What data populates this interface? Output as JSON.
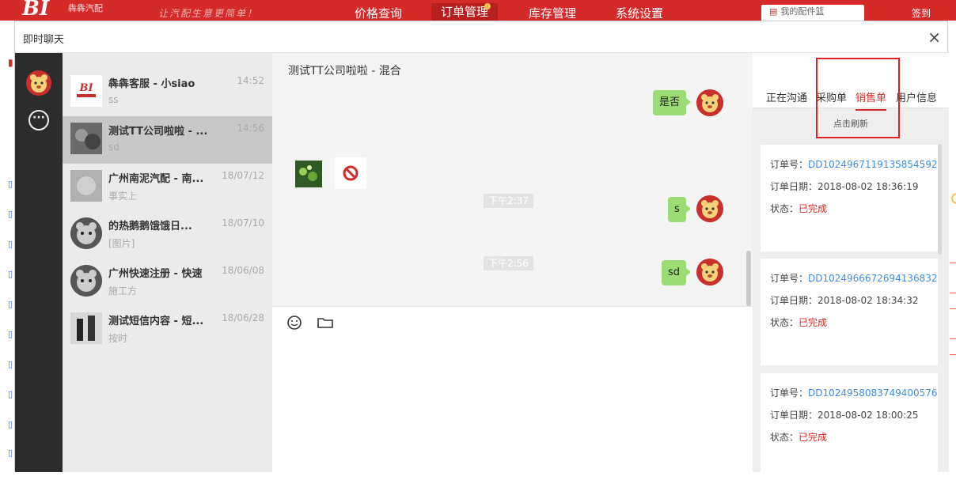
{
  "bg_app": {
    "logo": "BI",
    "brand": "犇犇汽配",
    "slogan": "让汽配生意更简单！",
    "nav": [
      "价格查询",
      "订单管理",
      "库存管理",
      "系统设置"
    ],
    "cart_label": "我的配件篮",
    "sign_label": "签到"
  },
  "window": {
    "title": "即时聊天",
    "close_glyph": "×"
  },
  "conversations": [
    {
      "name": "犇犇客服 - 小siao",
      "time": "14:52",
      "preview": "ss"
    },
    {
      "name": "测试TT公司啦啦 - ...",
      "time": "14:56",
      "preview": "sd"
    },
    {
      "name": "广州南泥汽配 - 南...",
      "time": "18/07/12",
      "preview": "事实上"
    },
    {
      "name": "的热鹅鹅饿饿日...",
      "time": "18/07/10",
      "preview": "[图片]"
    },
    {
      "name": "广州快速注册 - 快速",
      "time": "18/06/08",
      "preview": "施工方"
    },
    {
      "name": "测试短信内容 - 短...",
      "time": "18/06/28",
      "preview": "按时"
    }
  ],
  "chat": {
    "title": "测试TT公司啦啦 - 混合",
    "messages": {
      "m1": "是否",
      "ts1": "下午2:37",
      "m2": "s",
      "ts2": "下午2:56",
      "m3": "sd"
    }
  },
  "side": {
    "tabs": [
      "正在沟通",
      "采购单",
      "销售单",
      "用户信息"
    ],
    "active_tab": "销售单",
    "refresh_label": "点击刷新",
    "labels": {
      "order_no": "订单号：",
      "order_date": "订单日期：",
      "status": "状态："
    },
    "orders": [
      {
        "no": "DD1024967119135854592",
        "date": "2018-08-02 18:36:19",
        "status": "已完成"
      },
      {
        "no": "DD1024966672694136832",
        "date": "2018-08-02 18:34:32",
        "status": "已完成"
      },
      {
        "no": "DD1024958083749400576",
        "date": "2018-08-02 18:00:25",
        "status": "已完成"
      }
    ]
  },
  "colors": {
    "brand_red": "#d42a2a",
    "bubble_green": "#9bdc74",
    "link_blue": "#3a8ee6"
  }
}
